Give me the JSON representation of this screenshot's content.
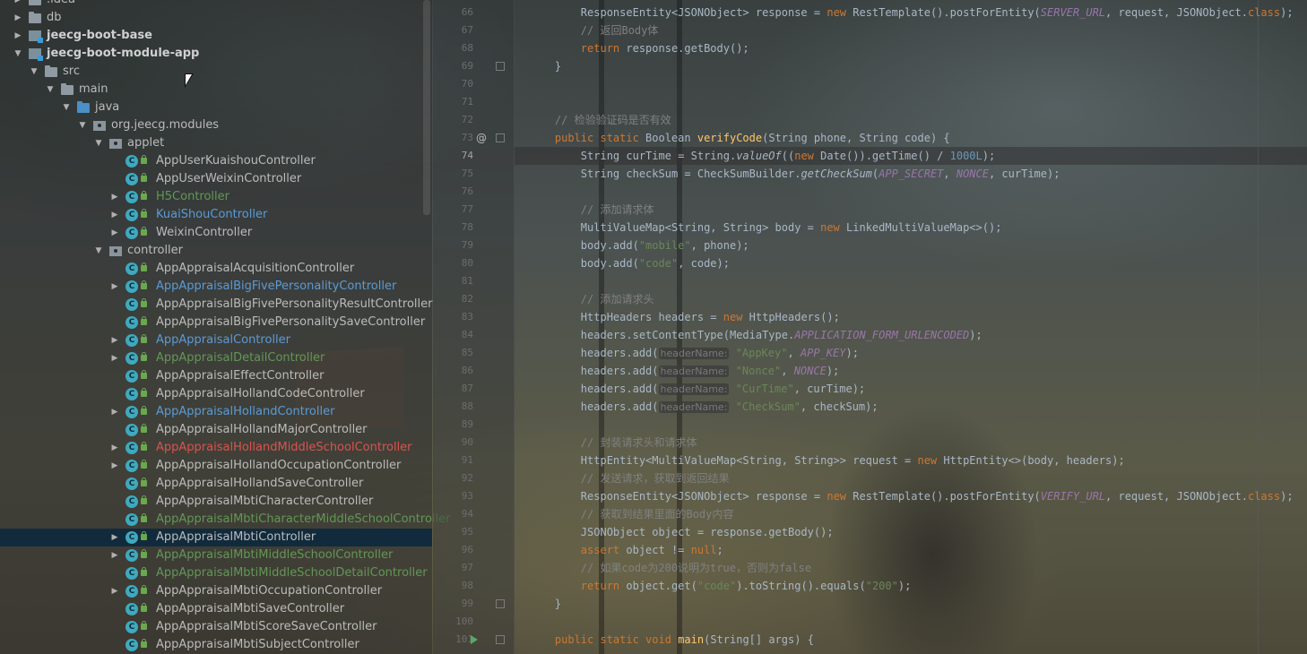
{
  "project_tree": {
    "rows": [
      {
        "label": ".idea",
        "icon": "folder-icon",
        "arrow": "collapsed",
        "color": "default",
        "bold": false
      },
      {
        "label": "db",
        "icon": "folder-icon",
        "arrow": "collapsed",
        "color": "default",
        "bold": false
      },
      {
        "label": "jeecg-boot-base",
        "icon": "module-icon",
        "arrow": "collapsed",
        "color": "default",
        "bold": true
      },
      {
        "label": "jeecg-boot-module-app",
        "icon": "module-icon",
        "arrow": "expanded",
        "color": "default",
        "bold": true
      },
      {
        "label": "src",
        "icon": "folder-icon",
        "arrow": "expanded",
        "color": "default",
        "bold": false
      },
      {
        "label": "main",
        "icon": "folder-icon",
        "arrow": "expanded",
        "color": "default",
        "bold": false
      },
      {
        "label": "java",
        "icon": "java-folder-icon",
        "arrow": "expanded",
        "color": "default",
        "bold": false
      },
      {
        "label": "org.jeecg.modules",
        "icon": "package-icon",
        "arrow": "expanded",
        "color": "default",
        "bold": false
      },
      {
        "label": "applet",
        "icon": "package-icon",
        "arrow": "expanded",
        "color": "default",
        "bold": false
      },
      {
        "label": "AppUserKuaishouController",
        "icon": "class-icon",
        "arrow": "none",
        "color": "default",
        "bold": false
      },
      {
        "label": "AppUserWeixinController",
        "icon": "class-icon",
        "arrow": "none",
        "color": "default",
        "bold": false
      },
      {
        "label": "H5Controller",
        "icon": "class-icon",
        "arrow": "collapsed",
        "color": "green",
        "bold": false
      },
      {
        "label": "KuaiShouController",
        "icon": "class-icon",
        "arrow": "collapsed",
        "color": "blue",
        "bold": false
      },
      {
        "label": "WeixinController",
        "icon": "class-icon",
        "arrow": "collapsed",
        "color": "default",
        "bold": false
      },
      {
        "label": "controller",
        "icon": "package-icon",
        "arrow": "expanded",
        "color": "default",
        "bold": false
      },
      {
        "label": "AppAppraisalAcquisitionController",
        "icon": "class-icon",
        "arrow": "none",
        "color": "default",
        "bold": false
      },
      {
        "label": "AppAppraisalBigFivePersonalityController",
        "icon": "class-icon",
        "arrow": "collapsed",
        "color": "blue",
        "bold": false
      },
      {
        "label": "AppAppraisalBigFivePersonalityResultController",
        "icon": "class-icon",
        "arrow": "none",
        "color": "default",
        "bold": false
      },
      {
        "label": "AppAppraisalBigFivePersonalitySaveController",
        "icon": "class-icon",
        "arrow": "none",
        "color": "default",
        "bold": false
      },
      {
        "label": "AppAppraisalController",
        "icon": "class-icon",
        "arrow": "collapsed",
        "color": "blue",
        "bold": false
      },
      {
        "label": "AppAppraisalDetailController",
        "icon": "class-icon",
        "arrow": "collapsed",
        "color": "green",
        "bold": false
      },
      {
        "label": "AppAppraisalEffectController",
        "icon": "class-icon",
        "arrow": "none",
        "color": "default",
        "bold": false
      },
      {
        "label": "AppAppraisalHollandCodeController",
        "icon": "class-icon",
        "arrow": "none",
        "color": "default",
        "bold": false
      },
      {
        "label": "AppAppraisalHollandController",
        "icon": "class-icon",
        "arrow": "collapsed",
        "color": "blue",
        "bold": false
      },
      {
        "label": "AppAppraisalHollandMajorController",
        "icon": "class-icon",
        "arrow": "none",
        "color": "default",
        "bold": false
      },
      {
        "label": "AppAppraisalHollandMiddleSchoolController",
        "icon": "class-icon",
        "arrow": "collapsed",
        "color": "red",
        "bold": false
      },
      {
        "label": "AppAppraisalHollandOccupationController",
        "icon": "class-icon",
        "arrow": "collapsed",
        "color": "default",
        "bold": false
      },
      {
        "label": "AppAppraisalHollandSaveController",
        "icon": "class-icon",
        "arrow": "none",
        "color": "default",
        "bold": false
      },
      {
        "label": "AppAppraisalMbtiCharacterController",
        "icon": "class-icon",
        "arrow": "none",
        "color": "default",
        "bold": false
      },
      {
        "label": "AppAppraisalMbtiCharacterMiddleSchoolController",
        "icon": "class-icon",
        "arrow": "none",
        "color": "green",
        "bold": false
      },
      {
        "label": "AppAppraisalMbtiController",
        "icon": "class-icon",
        "arrow": "collapsed",
        "color": "default",
        "bold": false,
        "selected": true
      },
      {
        "label": "AppAppraisalMbtiMiddleSchoolController",
        "icon": "class-icon",
        "arrow": "collapsed",
        "color": "green",
        "bold": false
      },
      {
        "label": "AppAppraisalMbtiMiddleSchoolDetailController",
        "icon": "class-icon",
        "arrow": "none",
        "color": "green",
        "bold": false
      },
      {
        "label": "AppAppraisalMbtiOccupationController",
        "icon": "class-icon",
        "arrow": "collapsed",
        "color": "default",
        "bold": false
      },
      {
        "label": "AppAppraisalMbtiSaveController",
        "icon": "class-icon",
        "arrow": "none",
        "color": "default",
        "bold": false
      },
      {
        "label": "AppAppraisalMbtiScoreSaveController",
        "icon": "class-icon",
        "arrow": "none",
        "color": "default",
        "bold": false
      },
      {
        "label": "AppAppraisalMbtiSubjectController",
        "icon": "class-icon",
        "arrow": "none",
        "color": "default",
        "bold": false
      }
    ]
  },
  "editor": {
    "current_line": 74,
    "lines": [
      {
        "num": 66,
        "tokens": [
          [
            "        ResponseEntity<JSONObject> response = ",
            "default"
          ],
          [
            "new",
            "kw"
          ],
          [
            " RestTemplate().postForEntity(",
            "default"
          ],
          [
            "SERVER_URL",
            "const"
          ],
          [
            ", request, JSONObject.",
            "default"
          ],
          [
            "class",
            "kw"
          ],
          [
            ");",
            "default"
          ]
        ]
      },
      {
        "num": 67,
        "tokens": [
          [
            "        // 返回Body体",
            "cmt"
          ]
        ]
      },
      {
        "num": 68,
        "tokens": [
          [
            "        ",
            "default"
          ],
          [
            "return",
            "kw"
          ],
          [
            " response.getBody();",
            "default"
          ]
        ]
      },
      {
        "num": 69,
        "tokens": [
          [
            "    }",
            "default"
          ]
        ]
      },
      {
        "num": 70,
        "tokens": []
      },
      {
        "num": 71,
        "tokens": []
      },
      {
        "num": 72,
        "tokens": [
          [
            "    // 检验验证码是否有效",
            "cmt"
          ]
        ]
      },
      {
        "num": 73,
        "gutter": "@",
        "tokens": [
          [
            "    ",
            "default"
          ],
          [
            "public static",
            "kw"
          ],
          [
            " Boolean ",
            "default"
          ],
          [
            "verifyCode",
            "fn"
          ],
          [
            "(String phone, String code) {",
            "default"
          ]
        ]
      },
      {
        "num": 74,
        "tokens": [
          [
            "        String curTime = String.",
            "default"
          ],
          [
            "valueOf",
            "static"
          ],
          [
            "((",
            "default"
          ],
          [
            "new",
            "kw"
          ],
          [
            " Date()).getTime() / ",
            "default"
          ],
          [
            "1000L",
            "num"
          ],
          [
            ");",
            "default"
          ]
        ]
      },
      {
        "num": 75,
        "tokens": [
          [
            "        String checkSum = CheckSumBuilder.",
            "default"
          ],
          [
            "getCheckSum",
            "static"
          ],
          [
            "(",
            "default"
          ],
          [
            "APP_SECRET",
            "const"
          ],
          [
            ", ",
            "default"
          ],
          [
            "NONCE",
            "const"
          ],
          [
            ", curTime);",
            "default"
          ]
        ]
      },
      {
        "num": 76,
        "tokens": []
      },
      {
        "num": 77,
        "tokens": [
          [
            "        // 添加请求体",
            "cmt"
          ]
        ]
      },
      {
        "num": 78,
        "tokens": [
          [
            "        MultiValueMap<String, String> body = ",
            "default"
          ],
          [
            "new",
            "kw"
          ],
          [
            " LinkedMultiValueMap<>();",
            "default"
          ]
        ]
      },
      {
        "num": 79,
        "tokens": [
          [
            "        body.add(",
            "default"
          ],
          [
            "\"mobile\"",
            "str"
          ],
          [
            ", phone);",
            "default"
          ]
        ]
      },
      {
        "num": 80,
        "tokens": [
          [
            "        body.add(",
            "default"
          ],
          [
            "\"code\"",
            "str"
          ],
          [
            ", code);",
            "default"
          ]
        ]
      },
      {
        "num": 81,
        "tokens": []
      },
      {
        "num": 82,
        "tokens": [
          [
            "        // 添加请求头",
            "cmt"
          ]
        ]
      },
      {
        "num": 83,
        "tokens": [
          [
            "        HttpHeaders headers = ",
            "default"
          ],
          [
            "new",
            "kw"
          ],
          [
            " HttpHeaders();",
            "default"
          ]
        ]
      },
      {
        "num": 84,
        "tokens": [
          [
            "        headers.setContentType(MediaType.",
            "default"
          ],
          [
            "APPLICATION_FORM_URLENCODED",
            "const"
          ],
          [
            ");",
            "default"
          ]
        ]
      },
      {
        "num": 85,
        "tokens": [
          [
            "        headers.add(",
            "default"
          ],
          [
            "headerName:",
            "hint"
          ],
          [
            " ",
            "default"
          ],
          [
            "\"AppKey\"",
            "str"
          ],
          [
            ", ",
            "default"
          ],
          [
            "APP_KEY",
            "const"
          ],
          [
            ");",
            "default"
          ]
        ]
      },
      {
        "num": 86,
        "tokens": [
          [
            "        headers.add(",
            "default"
          ],
          [
            "headerName:",
            "hint"
          ],
          [
            " ",
            "default"
          ],
          [
            "\"Nonce\"",
            "str"
          ],
          [
            ", ",
            "default"
          ],
          [
            "NONCE",
            "const"
          ],
          [
            ");",
            "default"
          ]
        ]
      },
      {
        "num": 87,
        "tokens": [
          [
            "        headers.add(",
            "default"
          ],
          [
            "headerName:",
            "hint"
          ],
          [
            " ",
            "default"
          ],
          [
            "\"CurTime\"",
            "str"
          ],
          [
            ", curTime);",
            "default"
          ]
        ]
      },
      {
        "num": 88,
        "tokens": [
          [
            "        headers.add(",
            "default"
          ],
          [
            "headerName:",
            "hint"
          ],
          [
            " ",
            "default"
          ],
          [
            "\"CheckSum\"",
            "str"
          ],
          [
            ", checkSum);",
            "default"
          ]
        ]
      },
      {
        "num": 89,
        "tokens": []
      },
      {
        "num": 90,
        "tokens": [
          [
            "        // 封装请求头和请求体",
            "cmt"
          ]
        ]
      },
      {
        "num": 91,
        "tokens": [
          [
            "        HttpEntity<MultiValueMap<String, String>> request = ",
            "default"
          ],
          [
            "new",
            "kw"
          ],
          [
            " HttpEntity<>(body, headers);",
            "default"
          ]
        ]
      },
      {
        "num": 92,
        "tokens": [
          [
            "        // 发送请求，获取到返回结果",
            "cmt"
          ]
        ]
      },
      {
        "num": 93,
        "tokens": [
          [
            "        ResponseEntity<JSONObject> response = ",
            "default"
          ],
          [
            "new",
            "kw"
          ],
          [
            " RestTemplate().postForEntity(",
            "default"
          ],
          [
            "VERIFY_URL",
            "const"
          ],
          [
            ", request, JSONObject.",
            "default"
          ],
          [
            "class",
            "kw"
          ],
          [
            ");",
            "default"
          ]
        ]
      },
      {
        "num": 94,
        "tokens": [
          [
            "        // 获取到结果里面的Body内容",
            "cmt"
          ]
        ]
      },
      {
        "num": 95,
        "tokens": [
          [
            "        JSONObject object = response.getBody();",
            "default"
          ]
        ]
      },
      {
        "num": 96,
        "tokens": [
          [
            "        ",
            "default"
          ],
          [
            "assert",
            "kw"
          ],
          [
            " object != ",
            "default"
          ],
          [
            "null",
            "kw"
          ],
          [
            ";",
            "default"
          ]
        ]
      },
      {
        "num": 97,
        "tokens": [
          [
            "        // 如果code为200说明为true，否则为false",
            "cmt"
          ]
        ]
      },
      {
        "num": 98,
        "tokens": [
          [
            "        ",
            "default"
          ],
          [
            "return",
            "kw"
          ],
          [
            " object.get(",
            "default"
          ],
          [
            "\"code\"",
            "str"
          ],
          [
            ").toString().equals(",
            "default"
          ],
          [
            "\"200\"",
            "str"
          ],
          [
            ");",
            "default"
          ]
        ]
      },
      {
        "num": 99,
        "tokens": [
          [
            "    }",
            "default"
          ]
        ]
      },
      {
        "num": 100,
        "tokens": []
      },
      {
        "num": 101,
        "gutter": "run",
        "tokens": [
          [
            "    ",
            "default"
          ],
          [
            "public static void",
            "kw"
          ],
          [
            " ",
            "default"
          ],
          [
            "main",
            "fn"
          ],
          [
            "(String[] args) {",
            "default"
          ]
        ]
      }
    ]
  }
}
